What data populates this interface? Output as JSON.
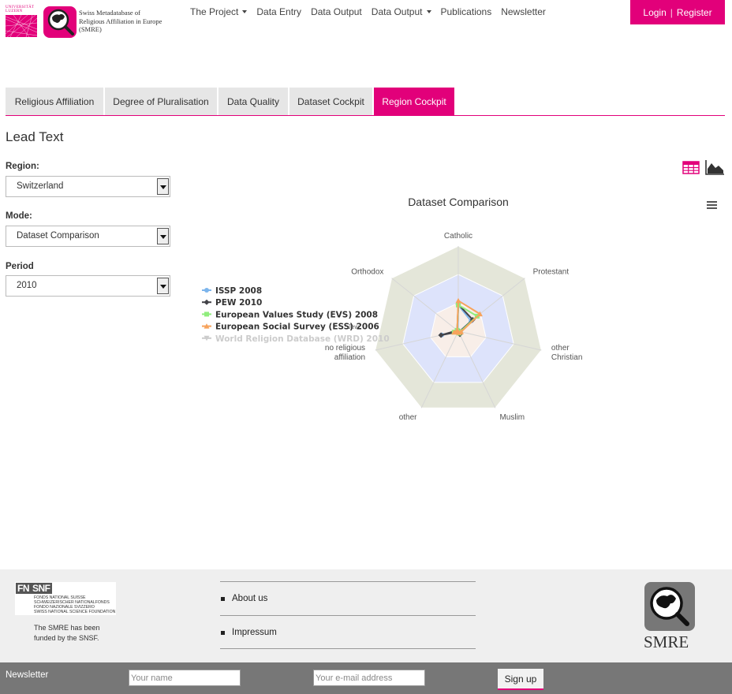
{
  "header": {
    "university_logo_text": "UNIVERSITÄT LUZERN",
    "brand_text": "Swiss Metadatabase of Religious Affiliation in Europe (SMRE)",
    "nav": [
      "The Project",
      "Data Entry",
      "Data Output",
      "Data Output",
      "Publications",
      "Newsletter"
    ],
    "login": "Login",
    "separator": "|",
    "register": "Register"
  },
  "tabs": [
    "Religious Affiliation",
    "Degree of Pluralisation",
    "Data Quality",
    "Dataset Cockpit",
    "Region Cockpit"
  ],
  "active_tab": "Region Cockpit",
  "lead_text": "Lead Text",
  "filters": {
    "region": {
      "label": "Region:",
      "value": "Switzerland"
    },
    "mode": {
      "label": "Mode:",
      "value": "Dataset Comparison"
    },
    "period": {
      "label": "Period",
      "value": "2010"
    }
  },
  "icons": {
    "table": "table-icon",
    "chart": "area-chart-icon",
    "menu": "hamburger-menu-icon"
  },
  "colors": {
    "accent": "#e2007a",
    "footer_bg": "#efefef",
    "newsletter_bg": "#777777"
  },
  "chart_data": {
    "type": "radar",
    "title": "Dataset Comparison",
    "categories": [
      "Catholic",
      "Protestant",
      "other Christian",
      "Muslim",
      "other",
      "no religious affiliation",
      "Orthodox",
      "Jew"
    ],
    "category_display": [
      [
        "Catholic"
      ],
      [
        "Protestant"
      ],
      [
        "other",
        "Christian"
      ],
      [
        "Muslim"
      ],
      [
        "other"
      ],
      [
        "no religious",
        "affiliation"
      ],
      [
        "Orthodox"
      ]
    ],
    "overlap_label": "Jew",
    "bands": [
      0.4,
      0.8,
      1.2
    ],
    "band_colors": [
      "#f8eee8",
      "#dde3fb",
      "#e4e6d9"
    ],
    "series": [
      {
        "name": "ISSP 2008",
        "color": "#7cb5ec",
        "marker": "circle",
        "values": [
          0.37,
          0.23,
          0.02,
          0.03,
          0.01,
          0.24,
          0.01,
          0.0
        ],
        "visible": true
      },
      {
        "name": "PEW 2010",
        "color": "#434348",
        "marker": "diamond",
        "values": [
          0.38,
          0.26,
          0.02,
          0.05,
          0.01,
          0.25,
          0.02,
          0.0
        ],
        "visible": true
      },
      {
        "name": "European Values Study (EVS) 2008",
        "color": "#90ed7d",
        "marker": "square",
        "values": [
          0.37,
          0.34,
          0.03,
          0.03,
          0.01,
          0.06,
          0.02,
          0.0
        ],
        "visible": true
      },
      {
        "name": "European Social Survey (ESS) 2006",
        "color": "#f7a35c",
        "marker": "triangle",
        "values": [
          0.43,
          0.39,
          0.04,
          0.02,
          0.01,
          0.06,
          0.02,
          0.0
        ],
        "visible": true
      },
      {
        "name": "World Religion Database (WRD) 2010",
        "color": "#cccccc",
        "marker": "triangle-down",
        "values": [
          0.0,
          0.0,
          0.0,
          0.0,
          0.0,
          0.0,
          0.0,
          0.0
        ],
        "visible": false
      }
    ],
    "legend_position": "left"
  },
  "footer": {
    "snf_logo": {
      "abbr1": "FN",
      "abbr2": "SNF",
      "lines": [
        "FONDS NATIONAL SUISSE",
        "SCHWEIZERISCHER NATIONALFONDS",
        "FONDO NAZIONALE SVIZZERO",
        "SWISS NATIONAL SCIENCE FOUNDATION"
      ]
    },
    "funded_text": "The SMRE has been funded by the SNSF.",
    "links": [
      "About us",
      "Impressum"
    ],
    "smre_logo_text": "SMRE"
  },
  "newsletter": {
    "label": "Newsletter",
    "name_placeholder": "Your name",
    "email_placeholder": "Your e-mail address",
    "signup": "Sign up"
  }
}
